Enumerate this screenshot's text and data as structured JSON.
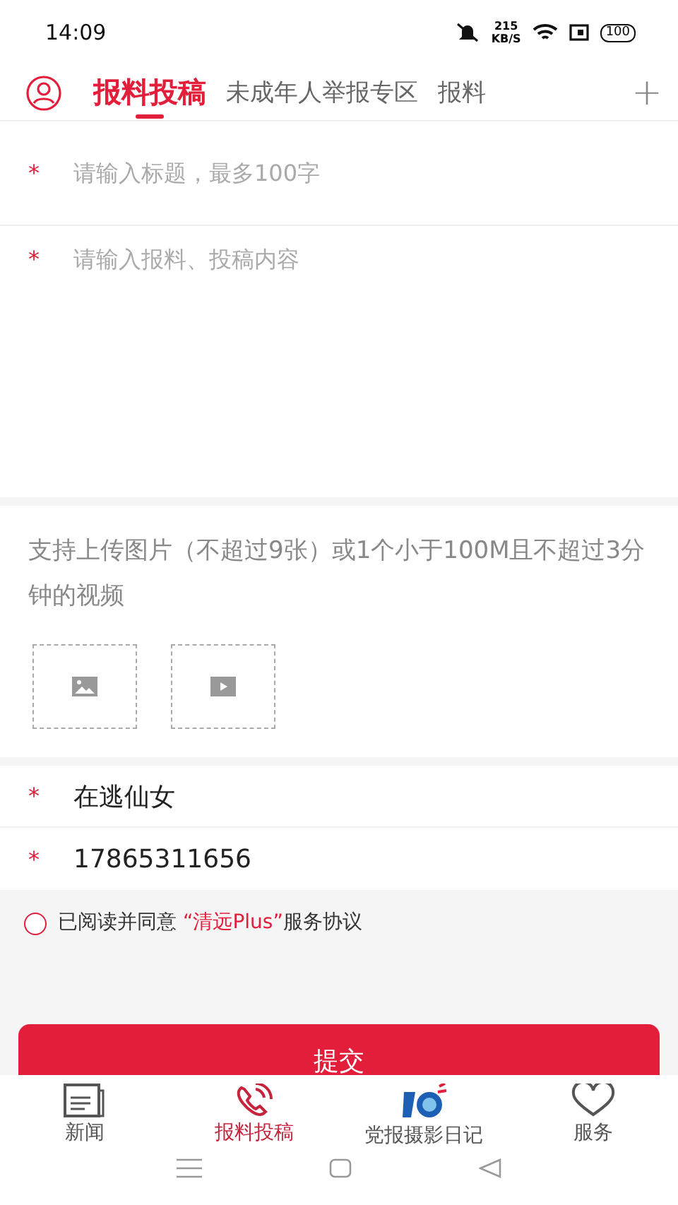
{
  "status_bar": {
    "time": "14:09",
    "net_speed": "215",
    "net_unit": "KB/S",
    "battery": "100"
  },
  "tabs": [
    {
      "label": "报料投稿",
      "selected": true
    },
    {
      "label": "未成年人举报专区",
      "selected": false
    },
    {
      "label": "报料",
      "selected": false
    }
  ],
  "add_tab": "+",
  "form": {
    "title_placeholder": "请输入标题，最多100字",
    "content_placeholder": "请输入报料、投稿内容",
    "required_mark": "*",
    "upload_hint": "支持上传图片（不超过9张）或1个小于100M且不超过3分钟的视频",
    "name": "在逃仙女",
    "phone": "17865311656"
  },
  "agreement": {
    "checked": false,
    "prefix": "已阅读并同意 ",
    "link": "“清远Plus”",
    "suffix": "服务协议"
  },
  "submit": "提交",
  "bottom_nav": [
    {
      "label": "新闻",
      "selected": false,
      "kind": "news"
    },
    {
      "label": "报料投稿",
      "selected": true,
      "kind": "phone"
    },
    {
      "label": "党报摄影日记",
      "selected": false,
      "kind": "photo"
    },
    {
      "label": "服务",
      "selected": false,
      "kind": "heart"
    }
  ]
}
